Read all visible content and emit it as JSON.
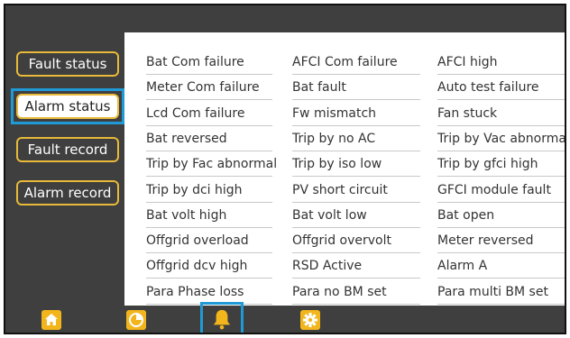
{
  "sidebar": {
    "items": [
      {
        "label": "Fault status"
      },
      {
        "label": "Alarm status"
      },
      {
        "label": "Fault record"
      },
      {
        "label": "Alarm record"
      }
    ]
  },
  "alarms": {
    "rows": [
      [
        "Bat Com failure",
        "AFCI Com failure",
        "AFCI high"
      ],
      [
        "Meter Com failure",
        "Bat fault",
        "Auto test failure"
      ],
      [
        "Lcd Com failure",
        "Fw mismatch",
        "Fan stuck"
      ],
      [
        "Bat reversed",
        "Trip by no AC",
        "Trip by Vac abnormal"
      ],
      [
        "Trip by Fac abnormal",
        "Trip by iso low",
        "Trip by gfci high"
      ],
      [
        "Trip by dci high",
        "PV short circuit",
        "GFCI module fault"
      ],
      [
        "Bat volt high",
        "Bat volt low",
        "Bat open"
      ],
      [
        "Offgrid overload",
        "Offgrid overvolt",
        "Meter reversed"
      ],
      [
        "Offgrid dcv high",
        "RSD Active",
        "Alarm A"
      ],
      [
        "Para Phase loss",
        "Para no BM set",
        "Para multi BM set"
      ]
    ]
  },
  "bottom_nav": {
    "icons": [
      "home-icon",
      "pie-chart-icon",
      "bell-icon",
      "gear-icon"
    ],
    "selected": "bell-icon"
  },
  "colors": {
    "background": "#3f3f3f",
    "accent_yellow": "#f2b51c",
    "selection_blue": "#1f9ad6"
  }
}
